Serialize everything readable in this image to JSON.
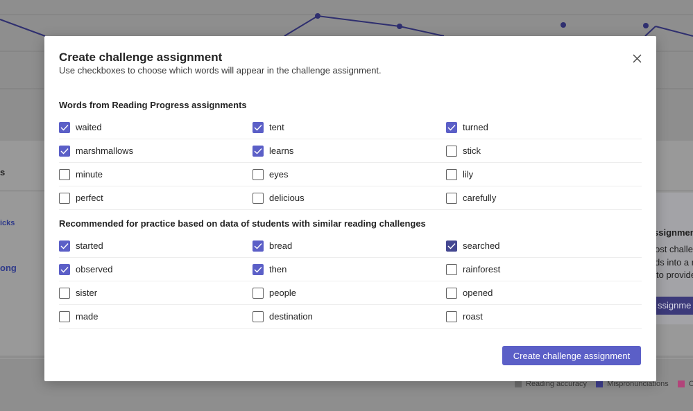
{
  "background": {
    "partial_texts": {
      "s": "s",
      "icks": "icks",
      "ong": "ong",
      "assignment_heading": "ssignment",
      "line1": "ost challer",
      "line2": "ds into a n",
      "line3": "to provide",
      "button": "ssignme"
    },
    "legend": [
      {
        "label": "Reading accuracy",
        "color": "#6f6f6f"
      },
      {
        "label": "Mispronunciations",
        "color": "#3f3f8f"
      },
      {
        "label": "O",
        "color": "#b2447a"
      }
    ]
  },
  "modal": {
    "title": "Create challenge assignment",
    "subtitle": "Use checkboxes to choose which words will appear in the challenge assignment.",
    "close_icon": "close-icon",
    "sections": [
      {
        "title": "Words from Reading Progress assignments",
        "rows": [
          [
            {
              "label": "waited",
              "checked": true
            },
            {
              "label": "tent",
              "checked": true
            },
            {
              "label": "turned",
              "checked": true
            }
          ],
          [
            {
              "label": "marshmallows",
              "checked": true
            },
            {
              "label": "learns",
              "checked": true
            },
            {
              "label": "stick",
              "checked": false
            }
          ],
          [
            {
              "label": "minute",
              "checked": false
            },
            {
              "label": "eyes",
              "checked": false
            },
            {
              "label": "lily",
              "checked": false
            }
          ],
          [
            {
              "label": "perfect",
              "checked": false
            },
            {
              "label": "delicious",
              "checked": false
            },
            {
              "label": "carefully",
              "checked": false
            }
          ]
        ]
      },
      {
        "title": "Recommended for practice based on data of students with similar reading challenges",
        "rows": [
          [
            {
              "label": "started",
              "checked": true
            },
            {
              "label": "bread",
              "checked": true
            },
            {
              "label": "searched",
              "checked": true,
              "focused": true
            }
          ],
          [
            {
              "label": "observed",
              "checked": true
            },
            {
              "label": "then",
              "checked": true
            },
            {
              "label": "rainforest",
              "checked": false
            }
          ],
          [
            {
              "label": "sister",
              "checked": false
            },
            {
              "label": "people",
              "checked": false
            },
            {
              "label": "opened",
              "checked": false
            }
          ],
          [
            {
              "label": "made",
              "checked": false
            },
            {
              "label": "destination",
              "checked": false
            },
            {
              "label": "roast",
              "checked": false
            }
          ]
        ]
      }
    ],
    "primary_button": "Create challenge assignment"
  },
  "colors": {
    "accent": "#5b5fc7",
    "accent_dark": "#444791"
  }
}
